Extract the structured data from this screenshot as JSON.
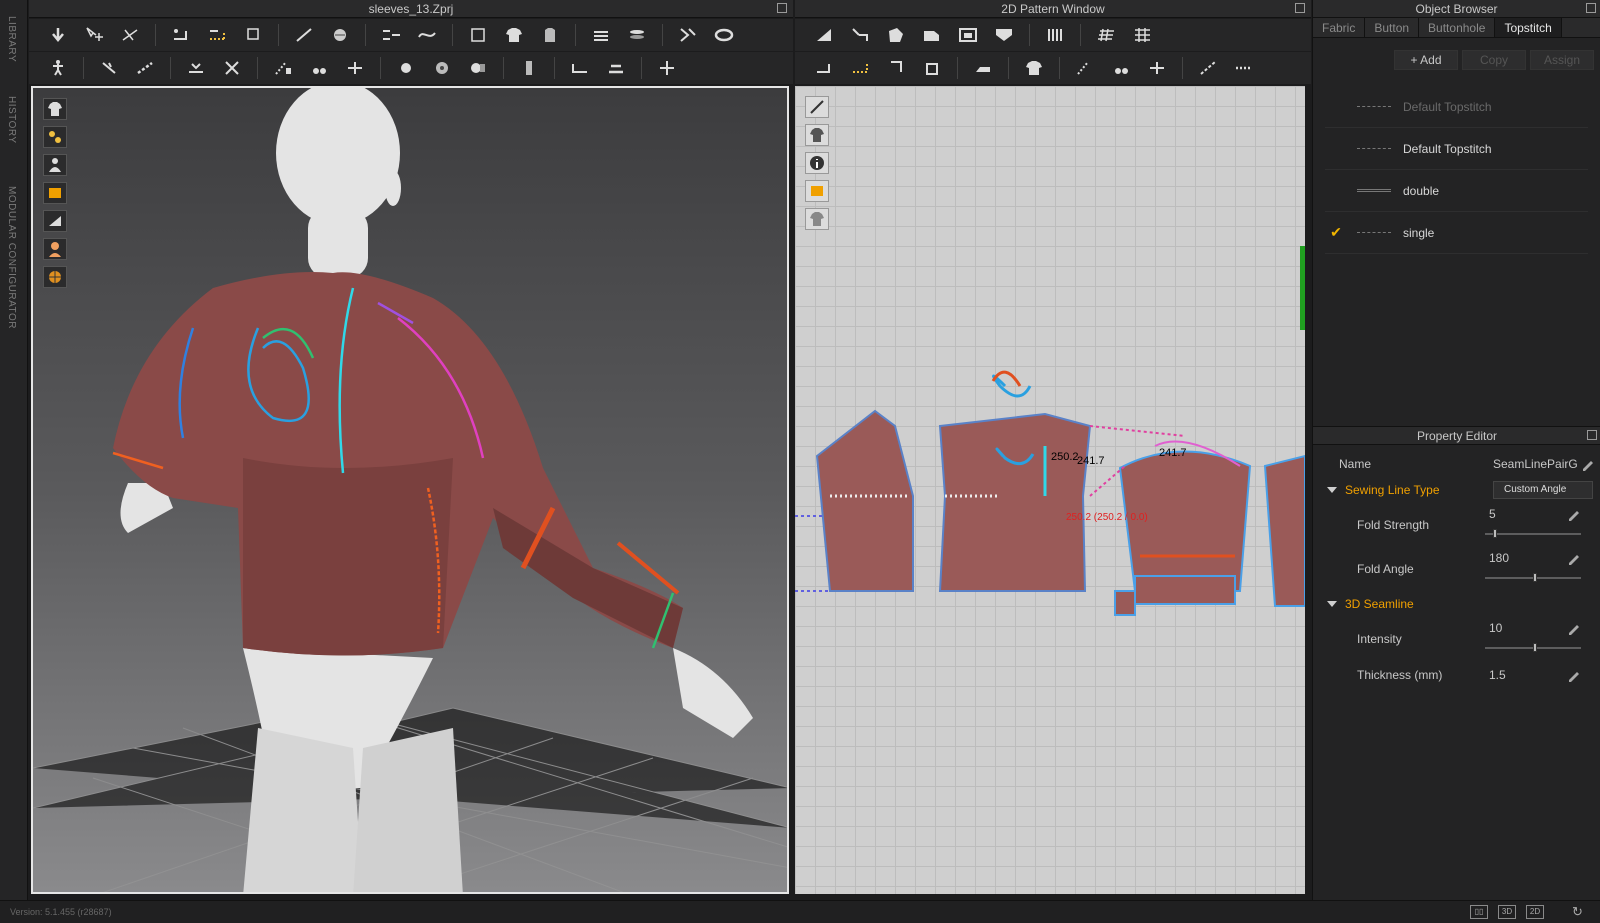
{
  "app": {
    "file_title": "sleeves_13.Zprj",
    "pattern_window_title": "2D Pattern Window",
    "version": "Version: 5.1.455 (r28687)"
  },
  "sidebar": {
    "items": [
      "LIBRARY",
      "HISTORY",
      "MODULAR CONFIGURATOR"
    ]
  },
  "view2d": {
    "measure_1": "250.2",
    "measure_2": "241.7",
    "measure_3": "241.7",
    "measure_red": "250.2 (250.2 / 0.0)"
  },
  "object_browser": {
    "title": "Object Browser",
    "tabs": [
      "Fabric",
      "Button",
      "Buttonhole",
      "Topstitch"
    ],
    "active_tab": "Topstitch",
    "buttons": {
      "add": "+ Add",
      "copy": "Copy",
      "assign": "Assign"
    },
    "items": [
      {
        "name": "Default Topstitch",
        "checked": false,
        "dim": true
      },
      {
        "name": "Default Topstitch",
        "checked": false,
        "dim": false
      },
      {
        "name": "double",
        "checked": false,
        "dim": false
      },
      {
        "name": "single",
        "checked": true,
        "dim": false
      }
    ]
  },
  "property_editor": {
    "title": "Property Editor",
    "name_label": "Name",
    "name_value": "SeamLinePairG",
    "sewing_section": "Sewing Line Type",
    "sewing_type": "Custom Angle",
    "fold_strength_label": "Fold Strength",
    "fold_strength": "5",
    "fold_strength_level": 0.08,
    "fold_angle_label": "Fold Angle",
    "fold_angle": "180",
    "fold_angle_level": 0.5,
    "seamline_section": "3D Seamline",
    "intensity_label": "Intensity",
    "intensity": "10",
    "intensity_level": 0.5,
    "thickness_label": "Thickness (mm)",
    "thickness": "1.5"
  },
  "statusbar": {
    "btn_3d": "3D",
    "btn_2d": "2D"
  }
}
